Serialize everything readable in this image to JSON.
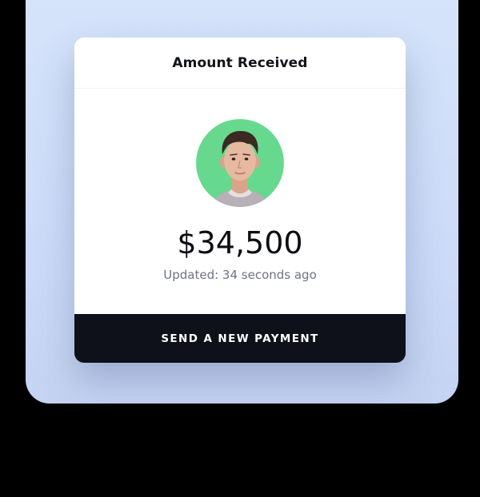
{
  "card": {
    "title": "Amount Received",
    "amount": "$34,500",
    "updated": "Updated: 34 seconds ago",
    "action_label": "SEND A NEW PAYMENT"
  },
  "avatar": {
    "icon": "user-avatar-photo",
    "background_color": "#66d98e"
  },
  "colors": {
    "backdrop": "#d6e4fb",
    "card": "#ffffff",
    "button": "#0f111a",
    "page_background": "#000000"
  }
}
